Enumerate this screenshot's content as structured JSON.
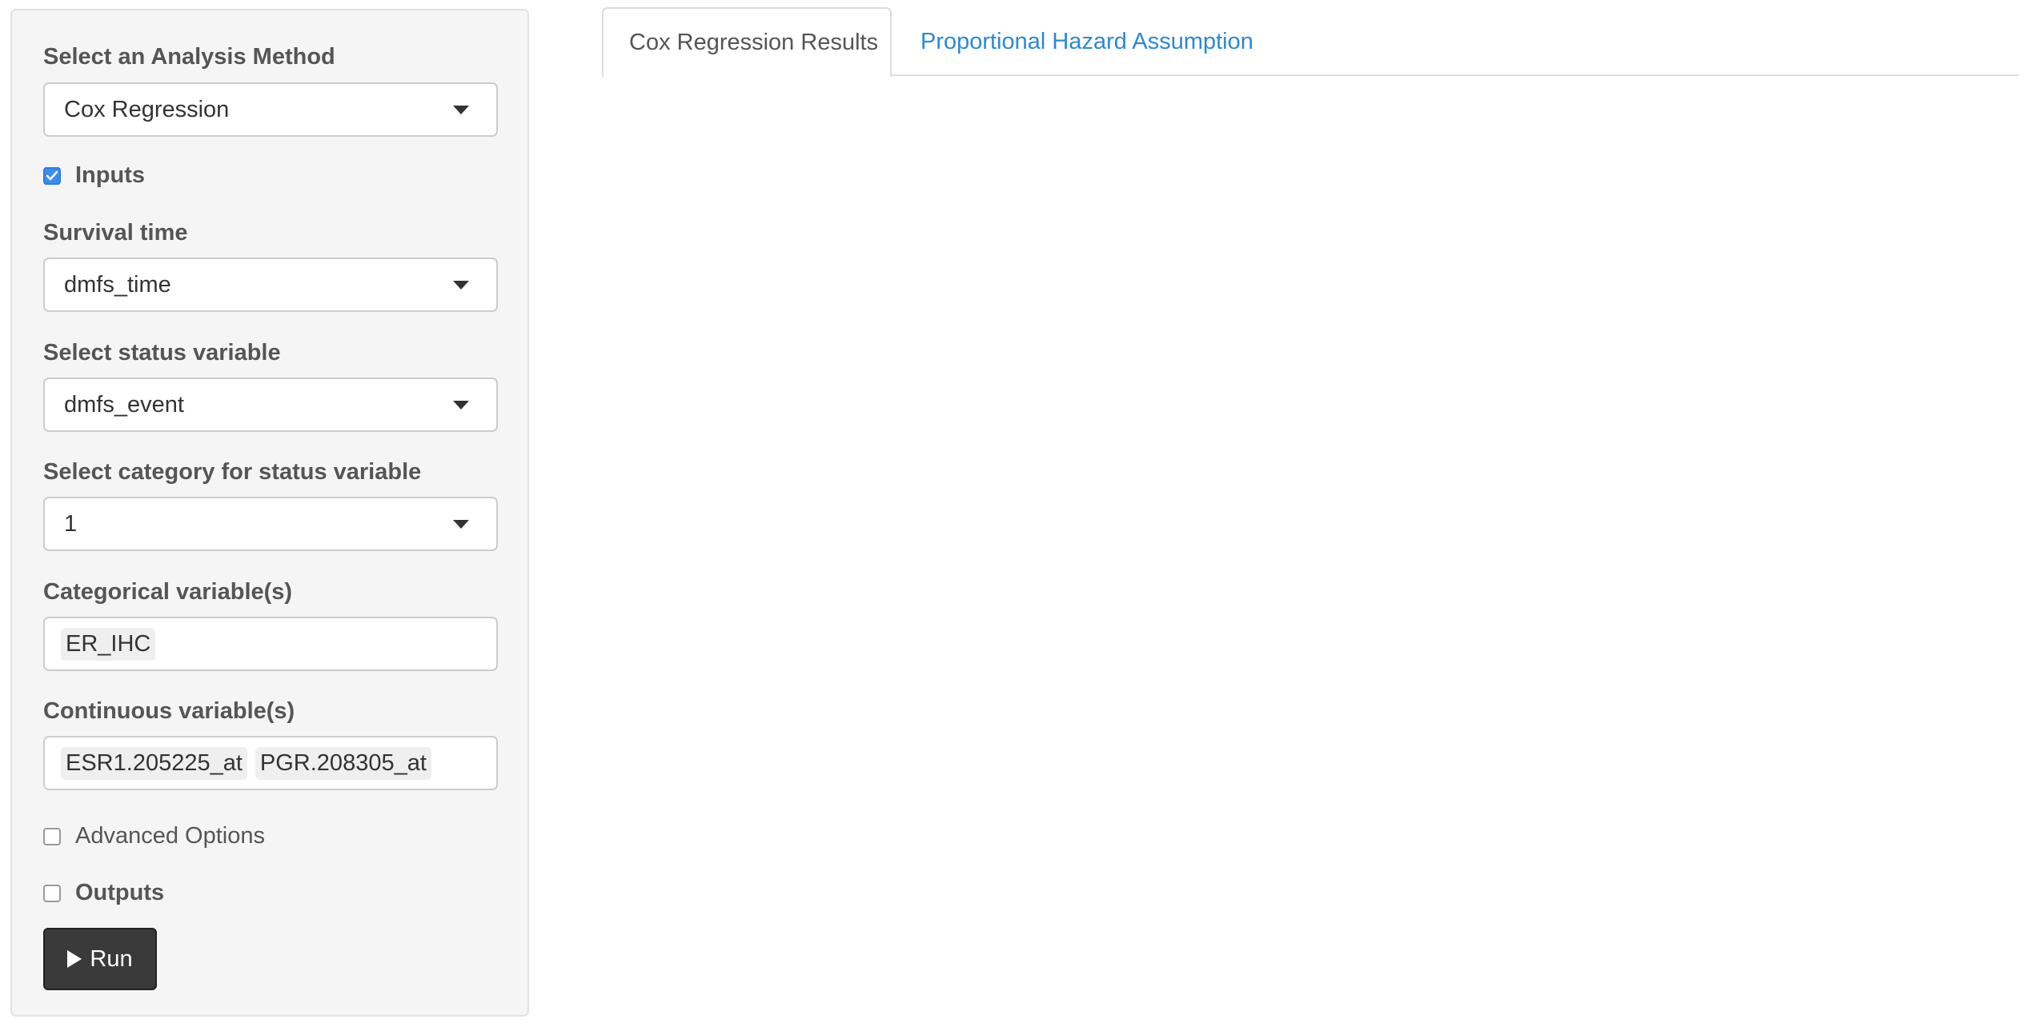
{
  "sidebar": {
    "method": {
      "label": "Select an Analysis Method",
      "value": "Cox Regression"
    },
    "inputs_toggle": {
      "label": "Inputs",
      "checked": true
    },
    "survival_time": {
      "label": "Survival time",
      "value": "dmfs_time"
    },
    "status_variable": {
      "label": "Select status variable",
      "value": "dmfs_event"
    },
    "status_category": {
      "label": "Select category for status variable",
      "value": "1"
    },
    "categorical": {
      "label": "Categorical variable(s)",
      "chips": [
        "ER_IHC"
      ]
    },
    "continuous": {
      "label": "Continuous variable(s)",
      "chips": [
        "ESR1.205225_at",
        "PGR.208305_at"
      ]
    },
    "advanced_toggle": {
      "label": "Advanced Options",
      "checked": false
    },
    "outputs_toggle": {
      "label": "Outputs",
      "checked": false
    },
    "run_label": "Run"
  },
  "tabs": [
    {
      "label": "Cox Regression Results",
      "active": true
    },
    {
      "label": "Proportional Hazard Assumption",
      "active": false
    }
  ],
  "colors": {
    "accent": "#3b8cf2",
    "link": "#2a8ad6",
    "run_button": "#3a3a3a"
  }
}
